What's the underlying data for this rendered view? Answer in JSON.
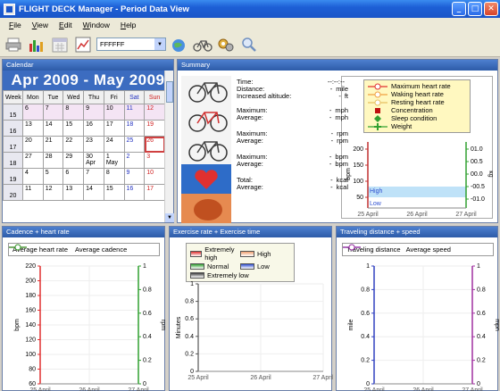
{
  "window": {
    "title": "FLIGHT DECK Manager - Period Data View"
  },
  "menu": [
    "File",
    "View",
    "Edit",
    "Window",
    "Help"
  ],
  "toolbar": {
    "color_value": "FFFFFF"
  },
  "calendar": {
    "panel_title": "Calendar",
    "range": "Apr 2009 - May 2009",
    "headers": [
      "Week",
      "Mon",
      "Tue",
      "Wed",
      "Thu",
      "Fri",
      "Sat",
      "Sun"
    ],
    "weeks": [
      {
        "wk": "15",
        "days": [
          "6",
          "7",
          "8",
          "9",
          "10",
          "11",
          "12"
        ]
      },
      {
        "wk": "16",
        "days": [
          "13",
          "14",
          "15",
          "16",
          "17",
          "18",
          "19"
        ]
      },
      {
        "wk": "17",
        "days": [
          "20",
          "21",
          "22",
          "23",
          "24",
          "25",
          "26"
        ]
      },
      {
        "wk": "18",
        "days": [
          "27",
          "28",
          "29",
          "30 Apr",
          "1 May",
          "2",
          "3"
        ]
      },
      {
        "wk": "19",
        "days": [
          "4",
          "5",
          "6",
          "7",
          "8",
          "9",
          "10"
        ]
      },
      {
        "wk": "20",
        "days": [
          "11",
          "12",
          "13",
          "14",
          "15",
          "16",
          "17"
        ]
      }
    ],
    "selected_day": "26"
  },
  "summary": {
    "panel_title": "Summary",
    "rows": [
      {
        "label": "Time:",
        "value": "--:--:--",
        "unit": ""
      },
      {
        "label": "Distance:",
        "value": "-",
        "unit": "mile"
      },
      {
        "label": "Increased altitude:",
        "value": "-",
        "unit": "ft"
      },
      {
        "label": "Maximum:",
        "value": "-",
        "unit": "mph"
      },
      {
        "label": "Average:",
        "value": "-",
        "unit": "mph"
      },
      {
        "label": "Maximum:",
        "value": "-",
        "unit": "rpm"
      },
      {
        "label": "Average:",
        "value": "-",
        "unit": "rpm"
      },
      {
        "label": "Maximum:",
        "value": "-",
        "unit": "bpm"
      },
      {
        "label": "Average:",
        "value": "-",
        "unit": "bpm"
      },
      {
        "label": "Total:",
        "value": "-",
        "unit": "kcal"
      },
      {
        "label": "Average:",
        "value": "-",
        "unit": "kcal"
      }
    ],
    "legend": [
      "Maximum heart rate",
      "Waking heart rate",
      "Resting heart rate",
      "Concentration",
      "Sleep condition",
      "Weight"
    ],
    "chart_data": {
      "type": "line",
      "x": [
        "25 April",
        "26 April",
        "27 April"
      ],
      "ylabel": "bpm",
      "y_ticks": [
        "200",
        "150",
        "100",
        "50"
      ],
      "y2_ticks": [
        "01.0",
        "00.5",
        "00.0",
        "-00.5",
        "-01.0"
      ],
      "y2_label": "kg",
      "bands": [
        "High",
        "Low"
      ],
      "series": []
    }
  },
  "cadence": {
    "panel_title": "Cadence + heart rate",
    "legend": [
      "Average heart rate",
      "Average cadence"
    ],
    "chart_data": {
      "type": "line",
      "x": [
        "25 April",
        "26 April",
        "27 April"
      ],
      "ylabel": "bpm",
      "y2label": "rpm",
      "ylim": [
        60,
        220
      ],
      "y_ticks": [
        "220",
        "200",
        "180",
        "160",
        "140",
        "120",
        "100",
        "80",
        "60"
      ],
      "y2_ticks": [
        "1",
        "0.8",
        "0.6",
        "0.4",
        "0.2",
        "0"
      ],
      "series": []
    }
  },
  "exercise": {
    "panel_title": "Exercise rate + Exercise time",
    "legend": [
      "Extremely high",
      "High",
      "Normal",
      "Low",
      "Extremely low"
    ],
    "chart_data": {
      "type": "bar",
      "x": [
        "25 April",
        "26 April",
        "27 April"
      ],
      "ylabel": "Minutes",
      "y_ticks": [
        "1",
        "0.8",
        "0.6",
        "0.4",
        "0.2",
        "0"
      ],
      "series": []
    }
  },
  "travel": {
    "panel_title": "Traveling distance + speed",
    "legend": [
      "Traveling distance",
      "Average speed"
    ],
    "chart_data": {
      "type": "line",
      "x": [
        "25 April",
        "26 April",
        "27 April"
      ],
      "ylabel": "mile",
      "y2label": "mph",
      "y_ticks": [
        "1",
        "0.8",
        "0.6",
        "0.4",
        "0.2",
        "0"
      ],
      "y2_ticks": [
        "1",
        "0.8",
        "0.6",
        "0.4",
        "0.2",
        "0"
      ],
      "series": []
    }
  }
}
